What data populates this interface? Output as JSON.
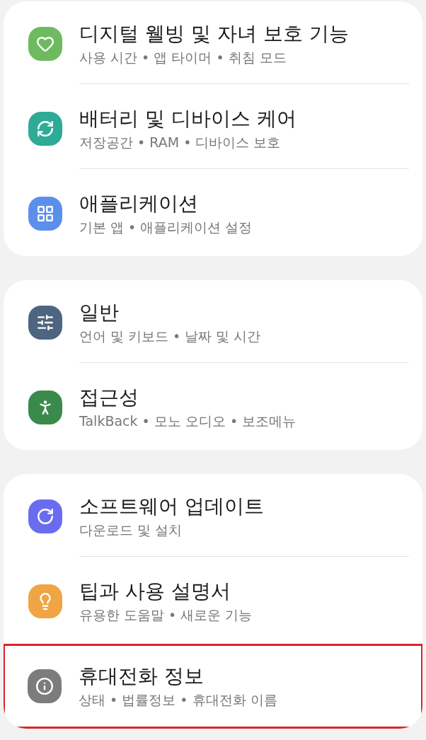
{
  "groups": [
    {
      "items": [
        {
          "title": "디지털 웰빙 및 자녀 보호 기능",
          "subtitle": "사용 시간 • 앱 타이머 • 취침 모드",
          "color": "#6dbb5e",
          "highlighted": false
        },
        {
          "title": "배터리 및 디바이스 케어",
          "subtitle": "저장공간 • RAM • 디바이스 보호",
          "color": "#2eab96",
          "highlighted": false
        },
        {
          "title": "애플리케이션",
          "subtitle": "기본 앱 • 애플리케이션 설정",
          "color": "#5b8fec",
          "highlighted": false
        }
      ]
    },
    {
      "items": [
        {
          "title": "일반",
          "subtitle": "언어 및 키보드 • 날짜 및 시간",
          "color": "#4d6580",
          "highlighted": false
        },
        {
          "title": "접근성",
          "subtitle": "TalkBack • 모노 오디오 • 보조메뉴",
          "color": "#3a8a4c",
          "highlighted": false
        }
      ]
    },
    {
      "items": [
        {
          "title": "소프트웨어 업데이트",
          "subtitle": "다운로드 및 설치",
          "color": "#6a6cf0",
          "highlighted": false
        },
        {
          "title": "팁과 사용 설명서",
          "subtitle": "유용한 도움말 • 새로운 기능",
          "color": "#f0a443",
          "highlighted": false
        },
        {
          "title": "휴대전화 정보",
          "subtitle": "상태 • 법률정보 • 휴대전화 이름",
          "color": "#7c7c7c",
          "highlighted": true
        }
      ]
    }
  ]
}
